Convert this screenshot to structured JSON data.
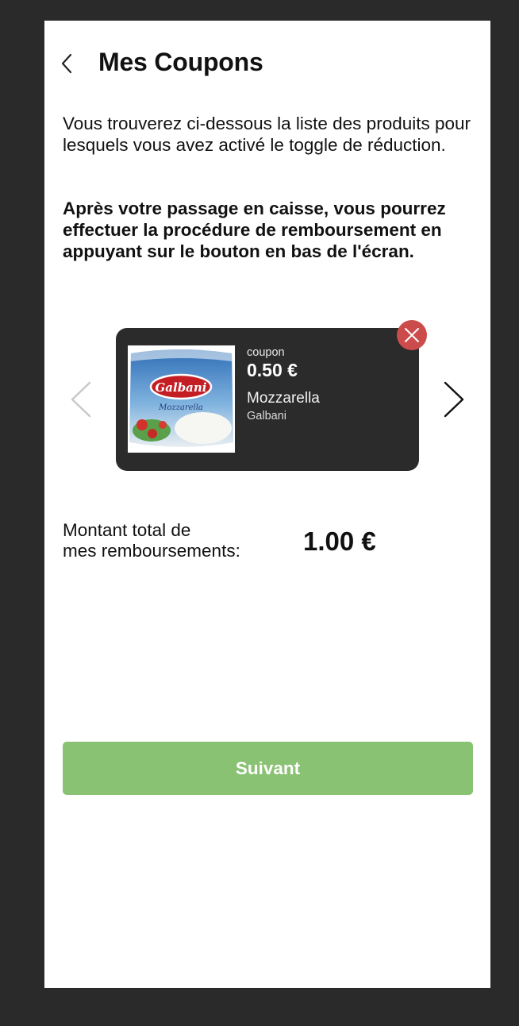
{
  "header": {
    "title": "Mes Coupons",
    "back_icon": "chevron-left-icon"
  },
  "intro": {
    "text": "Vous trouverez ci-dessous la liste des produits pour lesquels vous avez activé le toggle de réduction.",
    "bold_text": "Après votre passage en caisse, vous pourrez effectuer la procédure de remboursement en appuyant sur le bouton en bas de l'écran."
  },
  "carousel": {
    "prev_icon": "chevron-left-icon",
    "next_icon": "chevron-right-icon",
    "coupon": {
      "label": "coupon",
      "value": "0.50 €",
      "product_name": "Mozzarella",
      "brand": "Galbani",
      "image_logo_text": "Galbani",
      "image_product_text": "Mozzarella",
      "remove_icon": "close-icon"
    }
  },
  "total": {
    "label_line1": "Montant total de",
    "label_line2": "mes remboursements:",
    "value": "1.00 €"
  },
  "footer": {
    "next_label": "Suivant"
  },
  "colors": {
    "background": "#2a2a2a",
    "card": "#2b2b2b",
    "remove": "#cc4c4c",
    "primary_button": "#8ac273"
  }
}
